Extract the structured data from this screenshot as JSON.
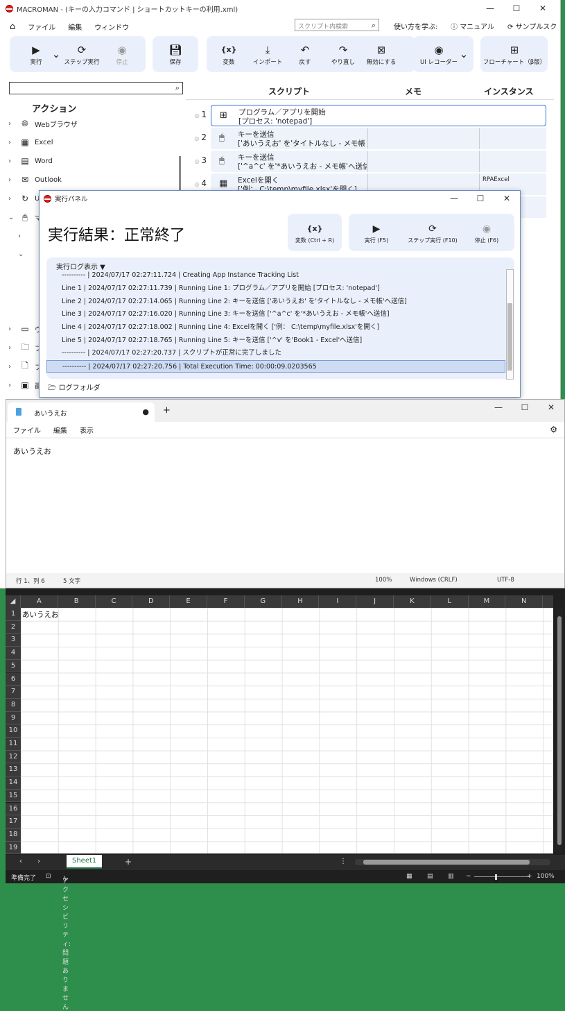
{
  "macroman": {
    "window_title": "MACROMAN - (キーの入力コマンド | ショートカットキーの利用.xml)",
    "menu": [
      "ファイル",
      "編集",
      "ウィンドウ"
    ],
    "search_placeholder": "スクリプト内検索",
    "learn_label": "使い方を学ぶ:",
    "manual_label": "マニュアル",
    "sample_label": "サンプルスク",
    "toolbar": {
      "run": "実行",
      "step_run": "ステップ実行",
      "stop": "停止",
      "save": "保存",
      "variables": "変数",
      "import": "インポート",
      "undo": "戻す",
      "redo": "やり直し",
      "disable": "無効にする",
      "ui_recorder": "UI レコーダー",
      "flowchart": "フローチャート（β版）"
    },
    "actions_title": "アクション",
    "actions": [
      {
        "label": "Webブラウザ",
        "icon": "globe-icon"
      },
      {
        "label": "Excel",
        "icon": "excel-icon"
      },
      {
        "label": "Word",
        "icon": "word-icon"
      },
      {
        "label": "Outlook",
        "icon": "outlook-icon"
      },
      {
        "label": "UI",
        "icon": "ui-icon"
      },
      {
        "label": "マ",
        "icon": "mouse-icon"
      },
      {
        "label": "ウ",
        "icon": "window-icon"
      },
      {
        "label": "フ",
        "icon": "folder-icon"
      },
      {
        "label": "フ",
        "icon": "file-icon"
      },
      {
        "label": "画",
        "icon": "image-icon"
      }
    ],
    "columns": {
      "script": "スクリプト",
      "memo": "メモ",
      "instance": "インスタンス"
    },
    "rows": [
      {
        "num": "1",
        "icon": "chip-icon",
        "line1": "プログラム／アプリを開始",
        "line2": "[プロセス: 'notepad']",
        "instance": ""
      },
      {
        "num": "2",
        "icon": "mouse-icon",
        "line1": "キーを送信",
        "line2": "['あいうえお' を'タイトルなし - メモ帳",
        "instance": ""
      },
      {
        "num": "3",
        "icon": "mouse-icon",
        "line1": "キーを送信",
        "line2": "['^a^c' を'*あいうえお - メモ帳'へ送信",
        "instance": ""
      },
      {
        "num": "4",
        "icon": "excel-icon",
        "line1": "Excelを開く",
        "line2": "['例： C:\\temp\\myfile.xlsx'を開く]",
        "instance": "RPAExcel"
      }
    ]
  },
  "exec_panel": {
    "title": "実行パネル",
    "result": "実行結果：正常終了",
    "variables": "変数 (Ctrl + R)",
    "run": "実行 (F5)",
    "step_run": "ステップ実行 (F10)",
    "stop": "停止 (F6)",
    "log_title": "実行ログ表示 ▼",
    "log": [
      "---------- | 2024/07/17 02:27:11.724 | Creating App Instance Tracking List",
      "Line 1     | 2024/07/17 02:27:11.739 | Running Line 1: プログラム／アプリを開始 [プロセス: 'notepad']",
      "Line 2     | 2024/07/17 02:27:14.065 | Running Line 2: キーを送信 ['あいうえお' を'タイトルなし - メモ帳'へ送信]",
      "Line 3     | 2024/07/17 02:27:16.020 | Running Line 3: キーを送信 ['^a^c' を'*あいうえお - メモ帳'へ送信]",
      "Line 4     | 2024/07/17 02:27:18.002 | Running Line 4: Excelを開く ['例： C:\\temp\\myfile.xlsx'を開く]",
      "Line 5     | 2024/07/17 02:27:18.765 | Running Line 5: キーを送信 ['^v' を'Book1 - Excel'へ送信]",
      "---------- | 2024/07/17 02:27:20.737 | スクリプトが正常に完了しました",
      "---------- | 2024/07/17 02:27:20.756 | Total Execution Time: 00:00:09.0203565"
    ],
    "log_folder": "ログフォルダ"
  },
  "notepad": {
    "tab_title": "あいうえお",
    "menu": [
      "ファイル",
      "編集",
      "表示"
    ],
    "content": "あいうえお",
    "status": {
      "position": "行 1、列 6",
      "chars": "5 文字",
      "zoom": "100%",
      "eol": "Windows (CRLF)",
      "encoding": "UTF-8"
    }
  },
  "excel": {
    "columns": [
      "A",
      "B",
      "C",
      "D",
      "E",
      "F",
      "G",
      "H",
      "I",
      "J",
      "K",
      "L",
      "M",
      "N"
    ],
    "rows": [
      "1",
      "2",
      "3",
      "4",
      "5",
      "6",
      "7",
      "8",
      "9",
      "10",
      "11",
      "12",
      "13",
      "14",
      "15",
      "16",
      "17",
      "18",
      "19"
    ],
    "a1": "あいうえお",
    "sheet": "Sheet1",
    "status_ready": "準備完了",
    "accessibility": "アクセシビリティ: 問題ありません",
    "zoom": "100%"
  }
}
